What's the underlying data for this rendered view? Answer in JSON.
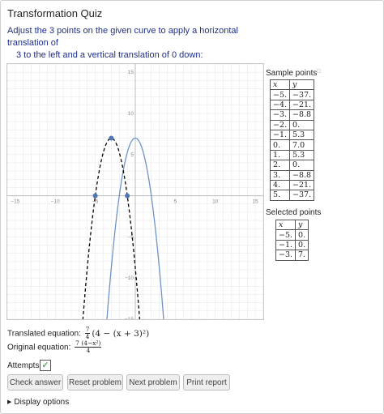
{
  "quiz": {
    "title": "Transformation Quiz",
    "prompt_line1": "Adjust the 3 points on the given curve to apply a horizontal translation of",
    "prompt_line2": "3  to the left and a vertical translation of 0  down:"
  },
  "graph": {
    "x_tick_labels": [
      "−15",
      "−10",
      "−5",
      "5",
      "10",
      "15"
    ],
    "x_tick_values": [
      -15,
      -10,
      -5,
      5,
      10,
      15
    ],
    "y_tick_labels": [
      "15",
      "10",
      "5",
      "−5",
      "−10",
      "−15"
    ],
    "y_tick_values": [
      15,
      10,
      5,
      -5,
      -10,
      -15
    ],
    "xlim": [
      -16,
      16
    ],
    "ylim": [
      -15,
      16
    ],
    "grid": true,
    "colors": {
      "original_curve": "#6f93c4",
      "translated_curve": "#000000",
      "points": "#4d77b8",
      "grid": "#e6e6e6"
    },
    "points": [
      {
        "x": -5,
        "y": 0
      },
      {
        "x": -1,
        "y": 0
      },
      {
        "x": -3,
        "y": 7
      }
    ]
  },
  "sample_points": {
    "label": "Sample points",
    "mark": "□",
    "header_x": "x",
    "header_y": "y",
    "rows": [
      [
        "−5.",
        "−37."
      ],
      [
        "−4.",
        "−21."
      ],
      [
        "−3.",
        "−8.8"
      ],
      [
        "−2.",
        "0."
      ],
      [
        "−1.",
        "5.3"
      ],
      [
        "0.",
        "7.0"
      ],
      [
        "1.",
        "5.3"
      ],
      [
        "2.",
        "0."
      ],
      [
        "3.",
        "−8.8"
      ],
      [
        "4.",
        "−21."
      ],
      [
        "5.",
        "−37."
      ]
    ]
  },
  "selected_points": {
    "label": "Selected points",
    "header_x": "x",
    "header_y": "y",
    "rows": [
      [
        "−5.",
        "0."
      ],
      [
        "−1.",
        "0."
      ],
      [
        "−3.",
        "7."
      ]
    ]
  },
  "equations": {
    "translated_label": "Translated equation:",
    "translated_frac_num": "7",
    "translated_frac_den": "4",
    "translated_rest": "(4 − (x + 3)²)",
    "original_label": "Original equation:",
    "original_num": "7 (4−x²)",
    "original_den": "4"
  },
  "attempts": {
    "label": "Attempts:",
    "check_glyph": "✓"
  },
  "buttons": {
    "check": "Check answer",
    "reset": "Reset problem",
    "next": "Next problem",
    "print": "Print report"
  },
  "display_options": {
    "label": "Display options",
    "glyph": "▶"
  }
}
